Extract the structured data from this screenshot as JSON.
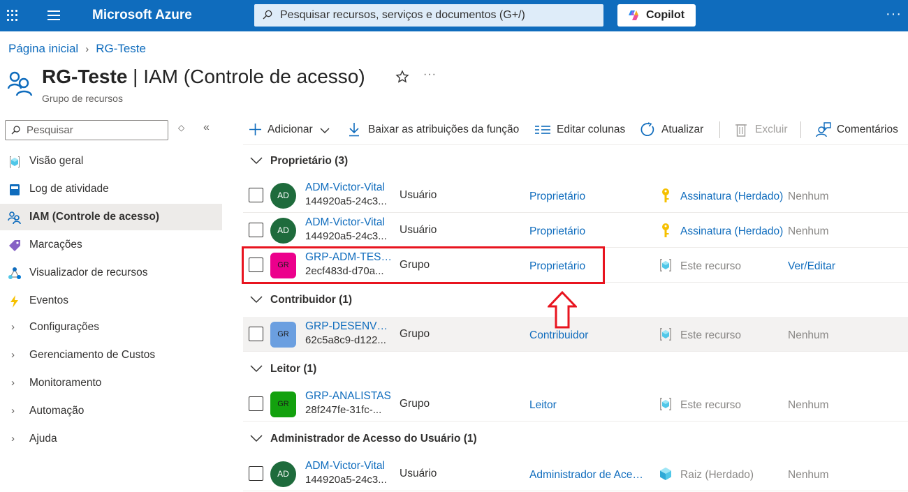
{
  "topbar": {
    "brand": "Microsoft Azure",
    "search_placeholder": "Pesquisar recursos, serviços e documentos (G+/)",
    "copilot_label": "Copilot",
    "more": "···"
  },
  "breadcrumb": {
    "home": "Página inicial",
    "current": "RG-Teste"
  },
  "header": {
    "title_bold": "RG-Teste",
    "title_rest": " | IAM (Controle de acesso)",
    "subtitle": "Grupo de recursos",
    "more": "···"
  },
  "nav": {
    "search_placeholder": "Pesquisar",
    "items": [
      {
        "label": "Visão geral",
        "icon": "resource-group-icon"
      },
      {
        "label": "Log de atividade",
        "icon": "activity-log-icon"
      },
      {
        "label": "IAM (Controle de acesso)",
        "icon": "iam-icon"
      },
      {
        "label": "Marcações",
        "icon": "tag-icon"
      },
      {
        "label": "Visualizador de recursos",
        "icon": "resource-visualizer-icon"
      },
      {
        "label": "Eventos",
        "icon": "lightning-icon"
      },
      {
        "label": "Configurações"
      },
      {
        "label": "Gerenciamento de Custos"
      },
      {
        "label": "Monitoramento"
      },
      {
        "label": "Automação"
      },
      {
        "label": "Ajuda"
      }
    ]
  },
  "toolbar": {
    "add": "Adicionar",
    "download": "Baixar as atribuições da função",
    "edit_columns": "Editar colunas",
    "refresh": "Atualizar",
    "delete": "Excluir",
    "feedback": "Comentários"
  },
  "groups": [
    {
      "label": "Proprietário (3)"
    },
    {
      "label": "Contribuidor (1)"
    },
    {
      "label": "Leitor (1)"
    },
    {
      "label": "Administrador de Acesso do Usuário (1)"
    }
  ],
  "rows": [
    {
      "avatar": "AD",
      "name": "ADM-Victor-Vital",
      "oid": "144920a5-24c3...",
      "type": "Usuário",
      "role": "Proprietário",
      "scope": "Assinatura (Herdado)",
      "condition": "Nenhum"
    },
    {
      "avatar": "AD",
      "name": "ADM-Victor-Vital",
      "oid": "144920a5-24c3...",
      "type": "Usuário",
      "role": "Proprietário",
      "scope": "Assinatura (Herdado)",
      "condition": "Nenhum"
    },
    {
      "avatar": "GR",
      "name": "GRP-ADM-TESTE",
      "oid": "2ecf483d-d70a...",
      "type": "Grupo",
      "role": "Proprietário",
      "scope": "Este recurso",
      "condition": "Ver/Editar"
    },
    {
      "avatar": "GR",
      "name": "GRP-DESENVOLVIMENTO",
      "oid": "62c5a8c9-d122...",
      "type": "Grupo",
      "role": "Contribuidor",
      "scope": "Este recurso",
      "condition": "Nenhum"
    },
    {
      "avatar": "GR",
      "name": "GRP-ANALISTAS",
      "oid": "28f247fe-31fc-...",
      "type": "Grupo",
      "role": "Leitor",
      "scope": "Este recurso",
      "condition": "Nenhum"
    },
    {
      "avatar": "AD",
      "name": "ADM-Victor-Vital",
      "oid": "144920a5-24c3...",
      "type": "Usuário",
      "role": "Administrador de Acesso do Usuário",
      "scope": "Raiz (Herdado)",
      "condition": "Nenhum"
    }
  ],
  "colors": {
    "brand_blue": "#0f6cbd",
    "avatar_user": "#1e6b3c",
    "avatar_grp_adm": "#ec008c",
    "avatar_grp_dev": "#6b9fe0",
    "avatar_grp_analistas": "#13a10e",
    "highlight": "#e8141f"
  }
}
